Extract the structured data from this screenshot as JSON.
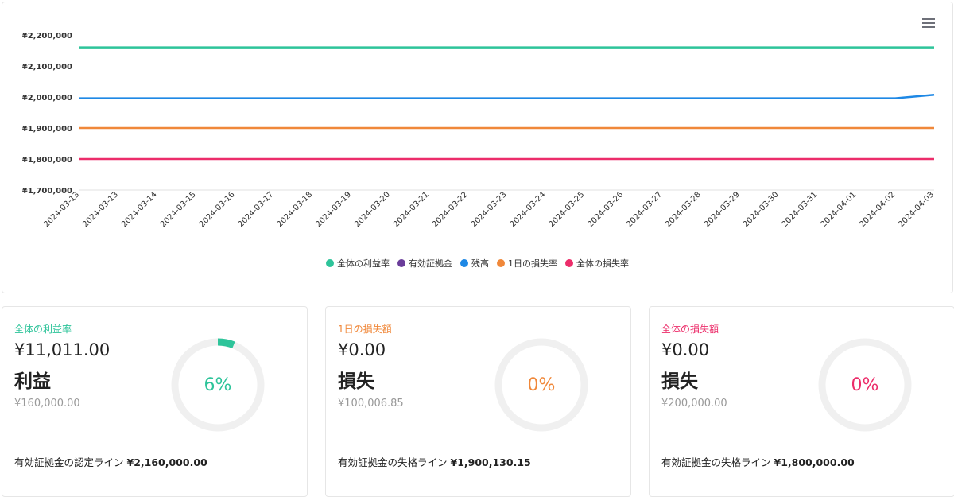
{
  "chart": {
    "menu_icon": "hamburger-menu-icon",
    "chart_data": {
      "type": "line",
      "x": [
        "2024-03-13",
        "2024-03-13",
        "2024-03-14",
        "2024-03-15",
        "2024-03-16",
        "2024-03-17",
        "2024-03-18",
        "2024-03-19",
        "2024-03-20",
        "2024-03-21",
        "2024-03-22",
        "2024-03-23",
        "2024-03-24",
        "2024-03-25",
        "2024-03-26",
        "2024-03-27",
        "2024-03-28",
        "2024-03-29",
        "2024-03-30",
        "2024-03-31",
        "2024-04-01",
        "2024-04-02",
        "2024-04-03"
      ],
      "yticks": [
        "¥2,200,000",
        "¥2,100,000",
        "¥2,000,000",
        "¥1,900,000",
        "¥1,800,000",
        "¥1,700,000"
      ],
      "ylim": [
        1700000,
        2200000
      ],
      "series": [
        {
          "name": "全体の利益率",
          "color": "#2ec49a",
          "values": [
            2160000,
            2160000,
            2160000,
            2160000,
            2160000,
            2160000,
            2160000,
            2160000,
            2160000,
            2160000,
            2160000,
            2160000,
            2160000,
            2160000,
            2160000,
            2160000,
            2160000,
            2160000,
            2160000,
            2160000,
            2160000,
            2160000,
            2160000
          ]
        },
        {
          "name": "有効証拠金",
          "color": "#6a3d9a",
          "values": []
        },
        {
          "name": "残高",
          "color": "#1e88e5",
          "values": [
            1996000,
            1996000,
            1996000,
            1996000,
            1996000,
            1996000,
            1996000,
            1996000,
            1996000,
            1996000,
            1996000,
            1996000,
            1996000,
            1996000,
            1996000,
            1996000,
            1996000,
            1996000,
            1996000,
            1996000,
            1996000,
            1996000,
            2007000
          ]
        },
        {
          "name": "1日の損失率",
          "color": "#f0883a",
          "values": [
            1900000,
            1900000,
            1900000,
            1900000,
            1900000,
            1900000,
            1900000,
            1900000,
            1900000,
            1900000,
            1900000,
            1900000,
            1900000,
            1900000,
            1900000,
            1900000,
            1900000,
            1900000,
            1900000,
            1900000,
            1900000,
            1900000,
            1900000
          ]
        },
        {
          "name": "全体の損失率",
          "color": "#ec2d6a",
          "values": [
            1800000,
            1800000,
            1800000,
            1800000,
            1800000,
            1800000,
            1800000,
            1800000,
            1800000,
            1800000,
            1800000,
            1800000,
            1800000,
            1800000,
            1800000,
            1800000,
            1800000,
            1800000,
            1800000,
            1800000,
            1800000,
            1800000,
            1800000
          ]
        }
      ],
      "legend_position": "bottom-center",
      "grid": false
    }
  },
  "cards": [
    {
      "title": "全体の利益率",
      "color": "#2ec49a",
      "amount": "¥11,011.00",
      "kind": "利益",
      "base": "¥160,000.00",
      "percent_label": "6%",
      "percent": 6,
      "line_label": "有効証拠金の認定ライン",
      "line_value": "¥2,160,000.00"
    },
    {
      "title": "1日の損失額",
      "color": "#f0883a",
      "amount": "¥0.00",
      "kind": "損失",
      "base": "¥100,006.85",
      "percent_label": "0%",
      "percent": 0,
      "line_label": "有効証拠金の失格ライン",
      "line_value": "¥1,900,130.15"
    },
    {
      "title": "全体の損失額",
      "color": "#ec2d6a",
      "amount": "¥0.00",
      "kind": "損失",
      "base": "¥200,000.00",
      "percent_label": "0%",
      "percent": 0,
      "line_label": "有効証拠金の失格ライン",
      "line_value": "¥1,800,000.00"
    }
  ]
}
